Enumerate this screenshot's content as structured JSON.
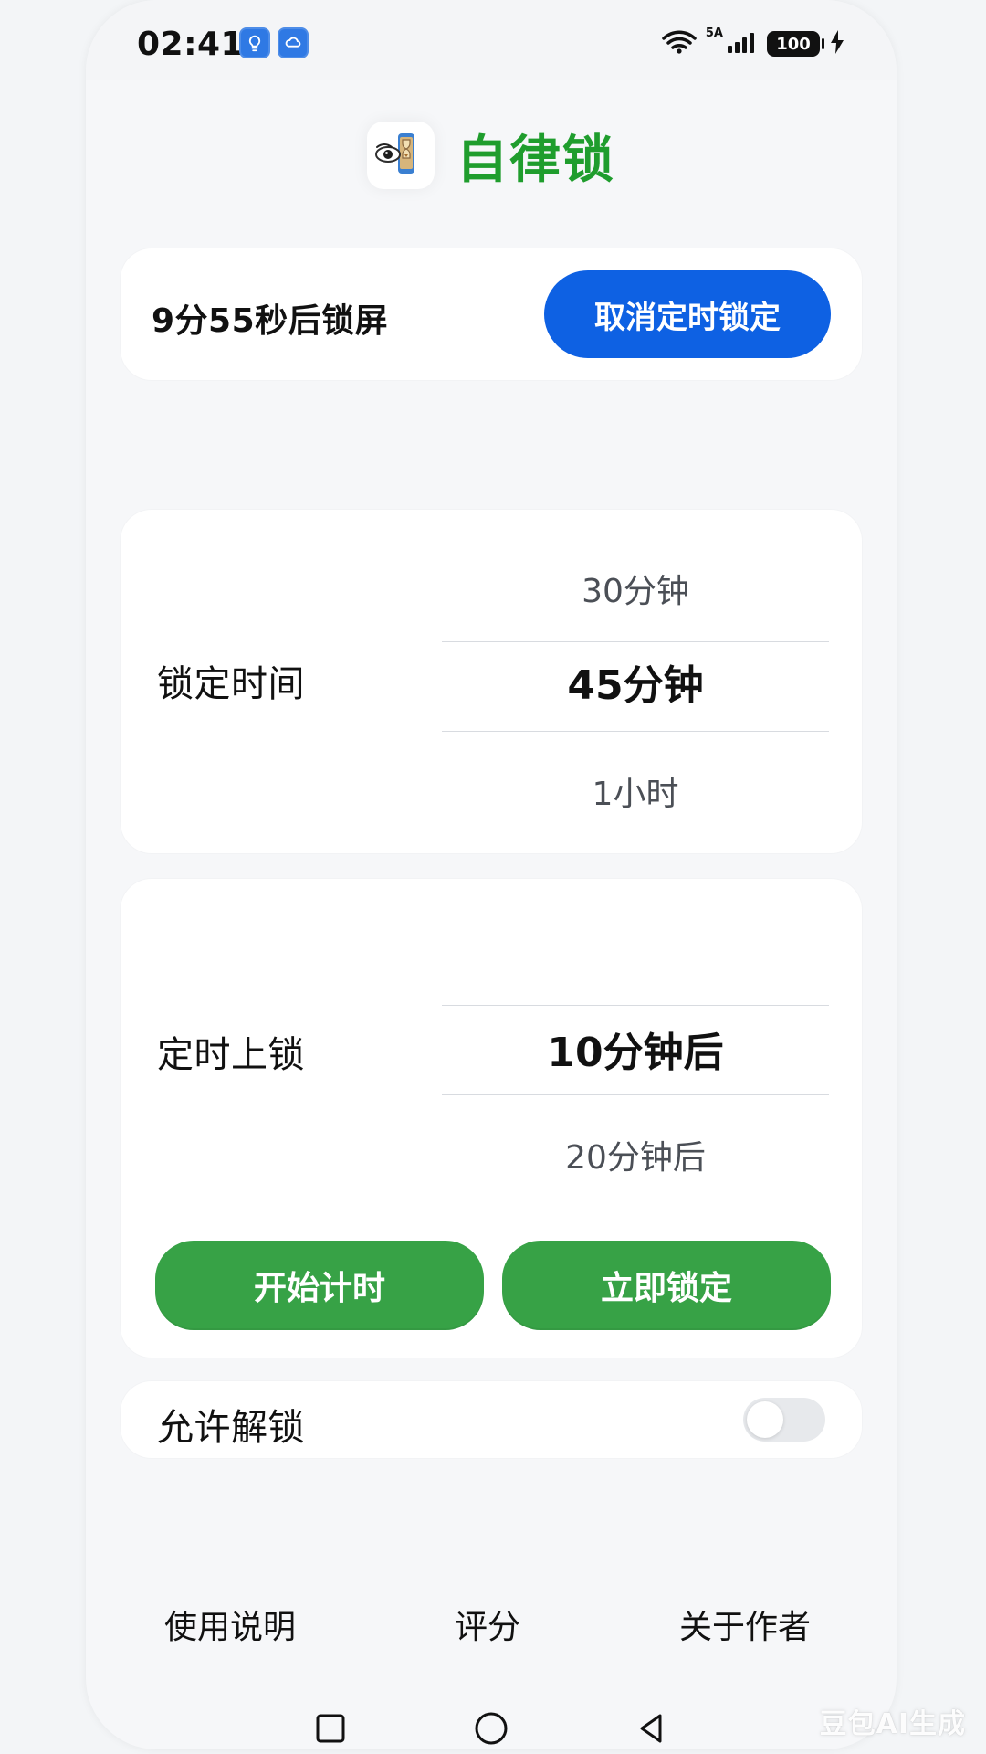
{
  "status_bar": {
    "time": "02:41",
    "network_label": "5A",
    "battery": "100"
  },
  "header": {
    "title": "自律锁"
  },
  "countdown_card": {
    "text": "9分55秒后锁屏",
    "cancel_label": "取消定时锁定"
  },
  "lock_duration": {
    "label": "锁定时间",
    "options": {
      "above": "30分钟",
      "selected": "45分钟",
      "below": "1小时"
    }
  },
  "timed_lock": {
    "label": "定时上锁",
    "options": {
      "selected": "10分钟后",
      "below": "20分钟后"
    },
    "start_label": "开始计时",
    "lock_now_label": "立即锁定"
  },
  "unlock_setting": {
    "label": "允许解锁",
    "enabled": false
  },
  "footer": {
    "instructions": "使用说明",
    "rate": "评分",
    "about_author": "关于作者"
  },
  "watermark": "豆包AI生成",
  "icons": {
    "app_logo": "eye-hourglass-icon",
    "status_left_1": "lightbulb-icon",
    "status_left_2": "cloud-icon",
    "wifi": "wifi-icon",
    "signal": "signal-icon",
    "charging": "lightning-icon",
    "nav_recent": "square-icon",
    "nav_home": "circle-icon",
    "nav_back": "triangle-back-icon"
  },
  "colors": {
    "accent_green": "#1f9d2d",
    "button_green": "#37a246",
    "button_blue": "#0e61e3"
  }
}
